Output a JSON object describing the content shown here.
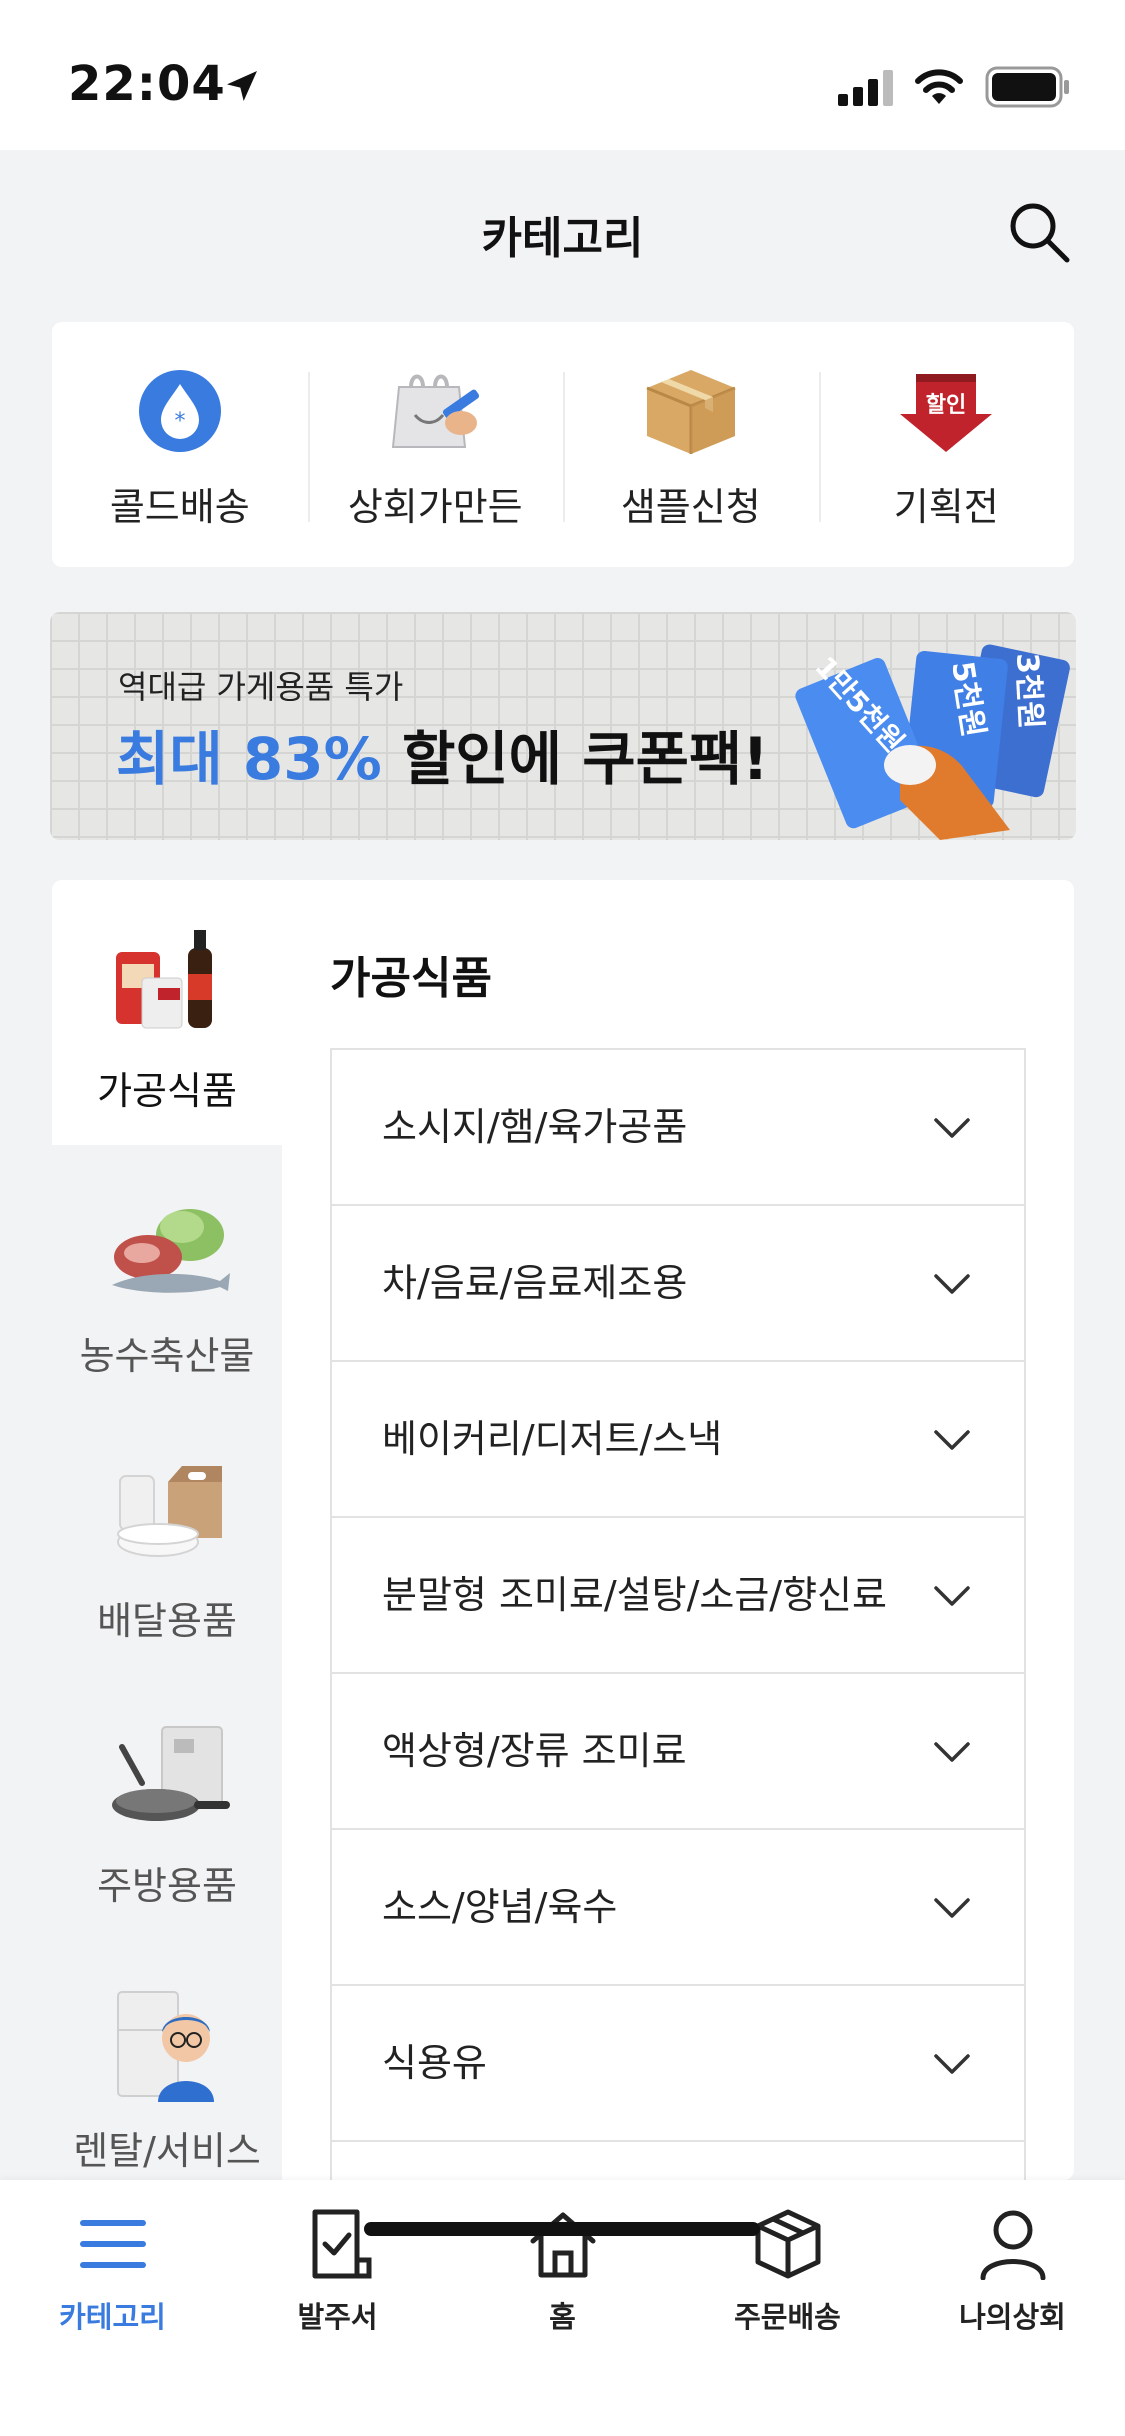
{
  "status_bar": {
    "time": "22:04"
  },
  "header": {
    "title": "카테고리"
  },
  "quick_menu": [
    {
      "label": "콜드배송",
      "icon": "cold-delivery-drop-icon"
    },
    {
      "label": "상회가만든",
      "icon": "bag-pen-icon"
    },
    {
      "label": "샘플신청",
      "icon": "box-icon"
    },
    {
      "label": "기획전",
      "icon": "sale-badge-icon",
      "badge": "할인"
    }
  ],
  "banner": {
    "subtitle": "역대급 가게용품 특가",
    "headline_highlight": "최대 83%",
    "headline_rest": " 할인에 쿠폰팩!",
    "coupons": [
      "1만5천원",
      "5천원",
      "3천원"
    ]
  },
  "sidebar": {
    "items": [
      {
        "label": "가공식품",
        "active": true
      },
      {
        "label": "농수축산물",
        "active": false
      },
      {
        "label": "배달용품",
        "active": false
      },
      {
        "label": "주방용품",
        "active": false
      },
      {
        "label": "렌탈/서비스",
        "active": false
      }
    ]
  },
  "content": {
    "title": "가공식품",
    "subcategories": [
      "소시지/햄/육가공품",
      "차/음료/음료제조용",
      "베이커리/디저트/스낵",
      "분말형 조미료/설탕/소금/향신료",
      "액상형/장류 조미료",
      "소스/양념/육수",
      "식용유"
    ]
  },
  "tab_bar": [
    {
      "label": "카테고리",
      "icon": "menu-icon",
      "active": true
    },
    {
      "label": "발주서",
      "icon": "order-sheet-icon",
      "active": false
    },
    {
      "label": "홈",
      "icon": "home-icon",
      "active": false
    },
    {
      "label": "주문배송",
      "icon": "package-icon",
      "active": false
    },
    {
      "label": "나의상회",
      "icon": "user-icon",
      "active": false
    }
  ],
  "colors": {
    "accent": "#3a7be0",
    "sale_red": "#c0232b"
  }
}
